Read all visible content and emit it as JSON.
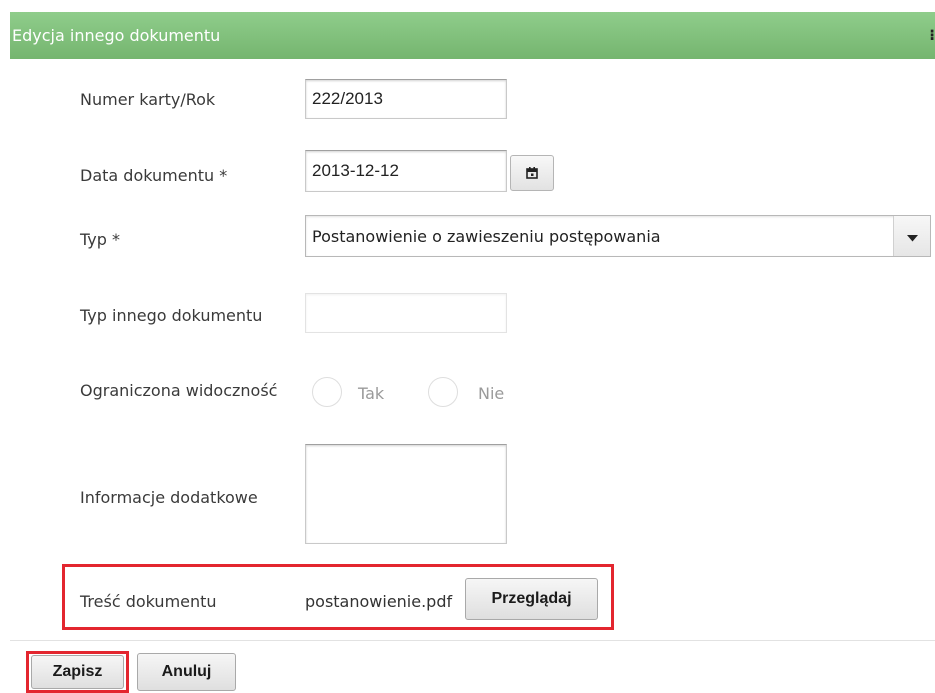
{
  "dialog": {
    "title": "Edycja innego dokumentu",
    "corner_glyph": "⁝"
  },
  "form": {
    "card_number": {
      "label": "Numer karty/Rok",
      "value": "222/2013"
    },
    "document_date": {
      "label": "Data dokumentu *",
      "value": "2013-12-12",
      "button_icon": "calendar-icon"
    },
    "type": {
      "label": "Typ *",
      "selected": "Postanowienie o zawieszeniu postępowania",
      "icon": "caret-down-icon"
    },
    "other_type": {
      "label": "Typ innego dokumentu",
      "value": ""
    },
    "restricted_visibility": {
      "label": "Ograniczona widoczność",
      "options": [
        "Tak",
        "Nie"
      ]
    },
    "additional_info": {
      "label": "Informacje dodatkowe",
      "value": ""
    },
    "document_content": {
      "label": "Treść dokumentu",
      "filename": "postanowienie.pdf",
      "browse_label": "Przeglądaj"
    }
  },
  "actions": {
    "save_label": "Zapisz",
    "cancel_label": "Anuluj"
  },
  "colors": {
    "header": "#7fc17a",
    "highlight": "#e3262f"
  }
}
